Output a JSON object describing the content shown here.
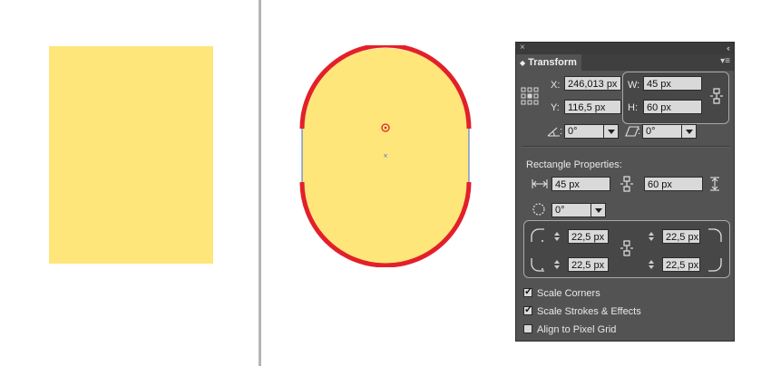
{
  "canvas": {
    "fill_color": "#FFE67A",
    "stroke_color": "#E3202A",
    "path_color": "#3B6FD6",
    "divider_color": "#B5B5B5"
  },
  "panel": {
    "title": "Transform",
    "close_icon": "×",
    "collapse_icon": "«",
    "menu_icon": "▾≡",
    "x_label": "X:",
    "x_value": "246,013 px",
    "y_label": "Y:",
    "y_value": "116,5 px",
    "w_label": "W:",
    "w_value": "45 px",
    "h_label": "H:",
    "h_value": "60 px",
    "rotate_value": "0°",
    "shear_value": "0°",
    "rect_section_title": "Rectangle Properties:",
    "rect_width": "45 px",
    "rect_height": "60 px",
    "rect_rotation": "0°",
    "corner_tl": "22,5 px",
    "corner_tr": "22,5 px",
    "corner_bl": "22,5 px",
    "corner_br": "22,5 px",
    "checkboxes": [
      {
        "label": "Scale Corners",
        "checked": true
      },
      {
        "label": "Scale Strokes & Effects",
        "checked": true
      },
      {
        "label": "Align to Pixel Grid",
        "checked": false
      }
    ]
  }
}
